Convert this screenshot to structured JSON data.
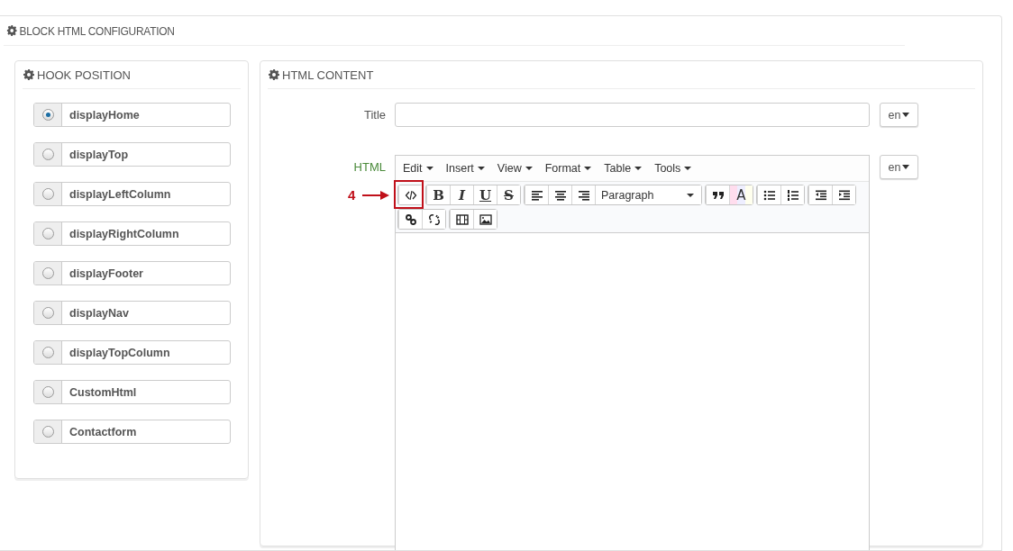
{
  "panel": {
    "title": "BLOCK HTML CONFIGURATION"
  },
  "hook_position": {
    "title": "HOOK POSITION",
    "options": [
      {
        "label": "displayHome",
        "selected": true
      },
      {
        "label": "displayTop",
        "selected": false
      },
      {
        "label": "displayLeftColumn",
        "selected": false
      },
      {
        "label": "displayRightColumn",
        "selected": false
      },
      {
        "label": "displayFooter",
        "selected": false
      },
      {
        "label": "displayNav",
        "selected": false
      },
      {
        "label": "displayTopColumn",
        "selected": false
      },
      {
        "label": "CustomHtml",
        "selected": false
      },
      {
        "label": "Contactform",
        "selected": false
      }
    ]
  },
  "html_content": {
    "title": "HTML CONTENT",
    "title_field": {
      "label": "Title",
      "language": "en"
    },
    "html_field": {
      "label": "HTML",
      "language": "en"
    },
    "editor": {
      "menus": [
        "Edit",
        "Insert",
        "View",
        "Format",
        "Table",
        "Tools"
      ],
      "toolbar_rows": [
        [
          [
            {
              "kind": "code"
            }
          ],
          [
            {
              "kind": "bold",
              "label": "B"
            },
            {
              "kind": "italic",
              "label": "I"
            },
            {
              "kind": "underline",
              "label": "U"
            },
            {
              "kind": "strike",
              "label": "S"
            }
          ],
          [
            {
              "kind": "align-left"
            },
            {
              "kind": "align-center"
            },
            {
              "kind": "align-right"
            },
            {
              "kind": "select",
              "label": "Paragraph"
            }
          ],
          [
            {
              "kind": "quote"
            },
            {
              "kind": "color",
              "label": "A"
            }
          ],
          [
            {
              "kind": "bullets"
            },
            {
              "kind": "numbers"
            }
          ],
          [
            {
              "kind": "outdent"
            },
            {
              "kind": "indent"
            }
          ]
        ],
        [
          [
            {
              "kind": "link"
            },
            {
              "kind": "unlink"
            }
          ],
          [
            {
              "kind": "film"
            },
            {
              "kind": "image"
            }
          ]
        ]
      ]
    },
    "annotation": {
      "label": "4"
    }
  }
}
